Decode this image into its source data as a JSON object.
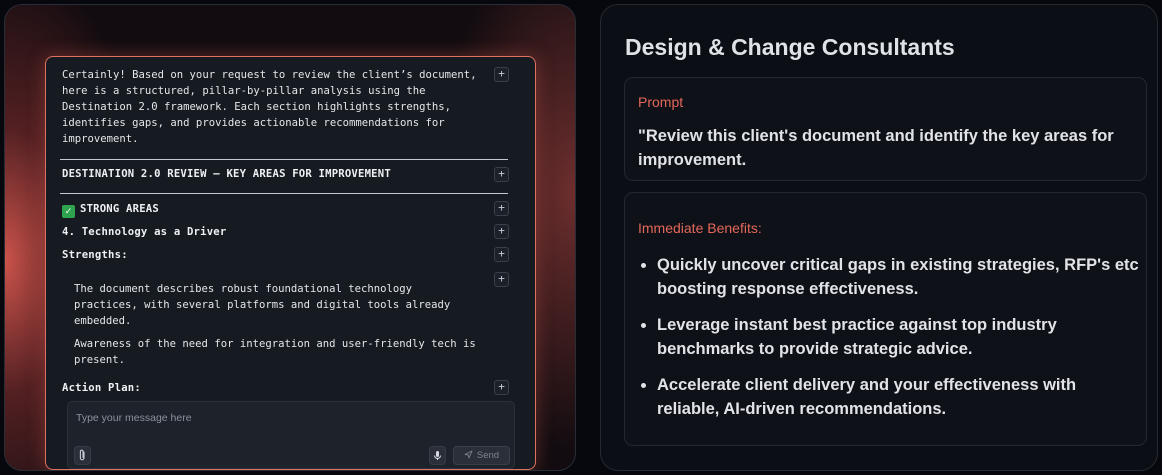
{
  "chat": {
    "intro": "Certainly! Based on your request to review the client’s document, here is a structured, pillar-by-pillar analysis using the Destination 2.0 framework. Each section highlights strengths, identifies gaps, and provides actionable recommendations for improvement.",
    "heading": "DESTINATION 2.0 REVIEW – KEY AREAS FOR IMPROVEMENT",
    "strong_areas": "STRONG AREAS",
    "section": "4. Technology as a Driver",
    "strengths_label": "Strengths:",
    "strength_1": "The document describes robust foundational technology practices, with several platforms and digital tools already embedded.",
    "strength_2": "Awareness of the need for integration and user-friendly tech is present.",
    "action_plan_label": "Action Plan:",
    "expand_symbol": "+",
    "composer": {
      "placeholder": "Type your message here",
      "send_label": "Send"
    }
  },
  "right": {
    "title": "Design & Change Consultants",
    "prompt_label": "Prompt",
    "prompt_text": "\"Review this client's document and identify the key areas for improvement.",
    "benefits_label": "Immediate Benefits:",
    "benefits": [
      "Quickly uncover critical gaps in existing strategies, RFP's etc boosting response effectiveness.",
      "Leverage instant best practice against top industry benchmarks to provide strategic advice.",
      "Accelerate client delivery and your effectiveness with reliable, AI-driven recommendations."
    ]
  },
  "colors": {
    "accent": "#e4685a",
    "check": "#2fa44f",
    "card_border": "#e0705f"
  },
  "icons": [
    "plus-icon",
    "check-icon",
    "paperclip-icon",
    "microphone-icon",
    "send-icon"
  ]
}
